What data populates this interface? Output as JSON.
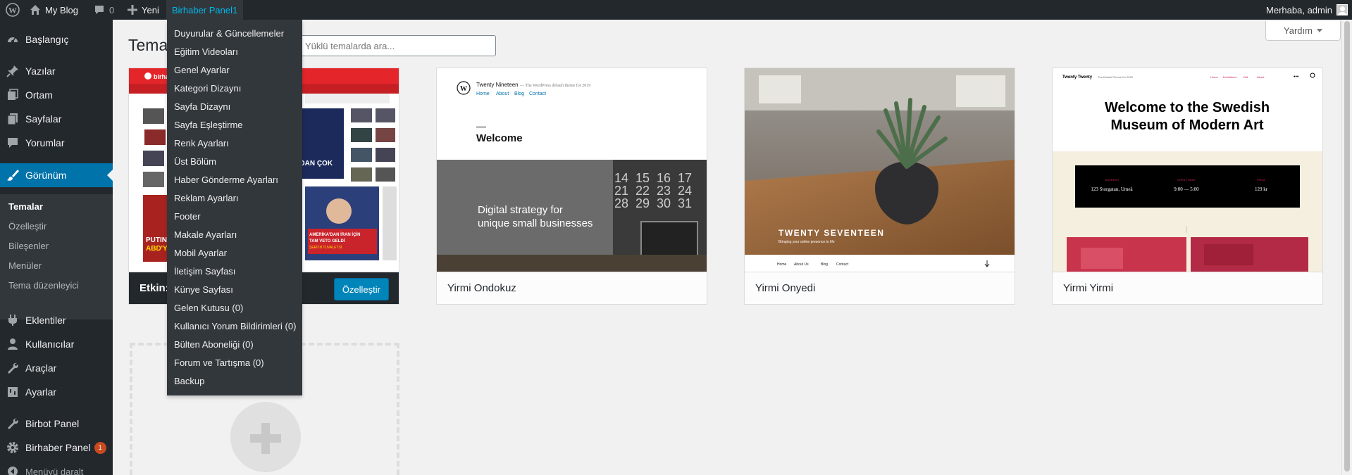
{
  "admin_bar": {
    "site_name": "My Blog",
    "comments_count": "0",
    "new_label": "Yeni",
    "active_menu": "Birhaber Panel1",
    "greeting": "Merhaba, admin"
  },
  "sidebar": {
    "items": [
      {
        "label": "Başlangıç",
        "icon": "dashboard-icon"
      },
      {
        "label": "Yazılar",
        "icon": "pin-icon"
      },
      {
        "label": "Ortam",
        "icon": "media-icon"
      },
      {
        "label": "Sayfalar",
        "icon": "page-icon"
      },
      {
        "label": "Yorumlar",
        "icon": "comment-icon"
      },
      {
        "label": "Görünüm",
        "icon": "brush-icon"
      },
      {
        "label": "Eklentiler",
        "icon": "plugin-icon"
      },
      {
        "label": "Kullanıcılar",
        "icon": "users-icon"
      },
      {
        "label": "Araçlar",
        "icon": "wrench-icon"
      },
      {
        "label": "Ayarlar",
        "icon": "settings-icon"
      },
      {
        "label": "Birbot Panel",
        "icon": "wrench-icon"
      },
      {
        "label": "Birhaber Panel",
        "icon": "gear-icon"
      }
    ],
    "birhaber_badge": "1",
    "submenu": [
      "Temalar",
      "Özelleştir",
      "Bileşenler",
      "Menüler",
      "Tema düzenleyici"
    ],
    "collapse_label": "Menüyü daralt"
  },
  "page": {
    "title": "Temalar",
    "search_placeholder": "Yüklü temalarda ara...",
    "help_label": "Yardım"
  },
  "themes": [
    {
      "name": "Etkin:",
      "customize": "Özelleştir"
    },
    {
      "name": "Yirmi Ondokuz"
    },
    {
      "name": "Yirmi Onyedi"
    },
    {
      "name": "Yirmi Yirmi"
    }
  ],
  "dropdown": [
    "Duyurular & Güncellemeler",
    "Eğitim Videoları",
    "Genel Ayarlar",
    "Kategori Dizaynı",
    "Sayfa Dizaynı",
    "Sayfa Eşleştirme",
    "Renk Ayarları",
    "Üst Bölüm",
    "Haber Gönderme Ayarları",
    "Reklam Ayarları",
    "Footer",
    "Makale Ayarları",
    "Mobil Ayarlar",
    "İletişim Sayfası",
    "Künye Sayfası",
    "Gelen Kutusu (0)",
    "Kullanıcı Yorum Bildirimleri (0)",
    "Bülten Aboneliği (0)",
    "Forum ve Tartışma (0)",
    "Backup"
  ],
  "screenshots": {
    "birhaber": {
      "logo": "birhaber",
      "headline1": "PUTIN",
      "headline2": "ABD'Y",
      "overlay": "'DAN ÇOK",
      "news1": "AMERİKA'DAN İRAN İÇİN",
      "news2": "TAM VETO GELDİ",
      "news3": "ŞERİ İN TUVALETSİ"
    },
    "nineteen": {
      "site": "Twenty Nineteen",
      "tagline": "— The WordPress default theme for 2019",
      "nav": [
        "Home",
        "About",
        "Blog",
        "Contact"
      ],
      "heading": "Welcome",
      "hero1": "Digital strategy for",
      "hero2": "unique small businesses",
      "cal": [
        "14",
        "15",
        "16",
        "17",
        "21",
        "22",
        "23",
        "24",
        "28",
        "29",
        "30",
        "31"
      ]
    },
    "seventeen": {
      "title": "TWENTY SEVENTEEN",
      "tagline": "Bringing your online presence to life",
      "nav": [
        "Home",
        "About Us",
        "Blog",
        "Contact"
      ]
    },
    "twenty": {
      "site": "Twenty Twenty",
      "tagline": "The Default Theme for 2020",
      "nav": [
        "Home",
        "Exhibitions",
        "Visit",
        "About"
      ],
      "heading1": "Welcome to the Swedish",
      "heading2": "Museum of Modern Art",
      "info_labels": [
        "ADDRESS",
        "OPEN TODAY",
        "PRICE"
      ],
      "info_values": [
        "123 Storgatan, Umeå",
        "9:00 — 5:00",
        "129 kr"
      ]
    }
  },
  "colors": {
    "admin_bar": "#23282d",
    "accent": "#0073aa",
    "submenu": "#32373c",
    "badge": "#ca4a1f",
    "button": "#0085ba"
  }
}
